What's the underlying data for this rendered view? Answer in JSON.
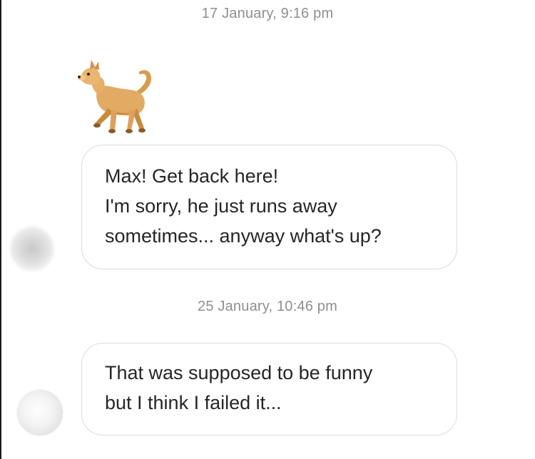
{
  "conversation": {
    "timestamp_1": "17 January, 9:16 pm",
    "timestamp_2": "25 January, 10:46 pm",
    "emoji_1": {
      "icon": "dog-emoji"
    },
    "message_1": {
      "lines": [
        "Max! Get back here!",
        "I'm sorry, he just runs away",
        "sometimes... anyway what's up?"
      ]
    },
    "message_2": {
      "lines": [
        "That was supposed to be funny",
        "but I think I failed it..."
      ]
    }
  },
  "colors": {
    "timestamp": "#8e8e93",
    "bubble_border": "#dcdcdc",
    "message_text": "#262626",
    "background": "#ffffff"
  }
}
